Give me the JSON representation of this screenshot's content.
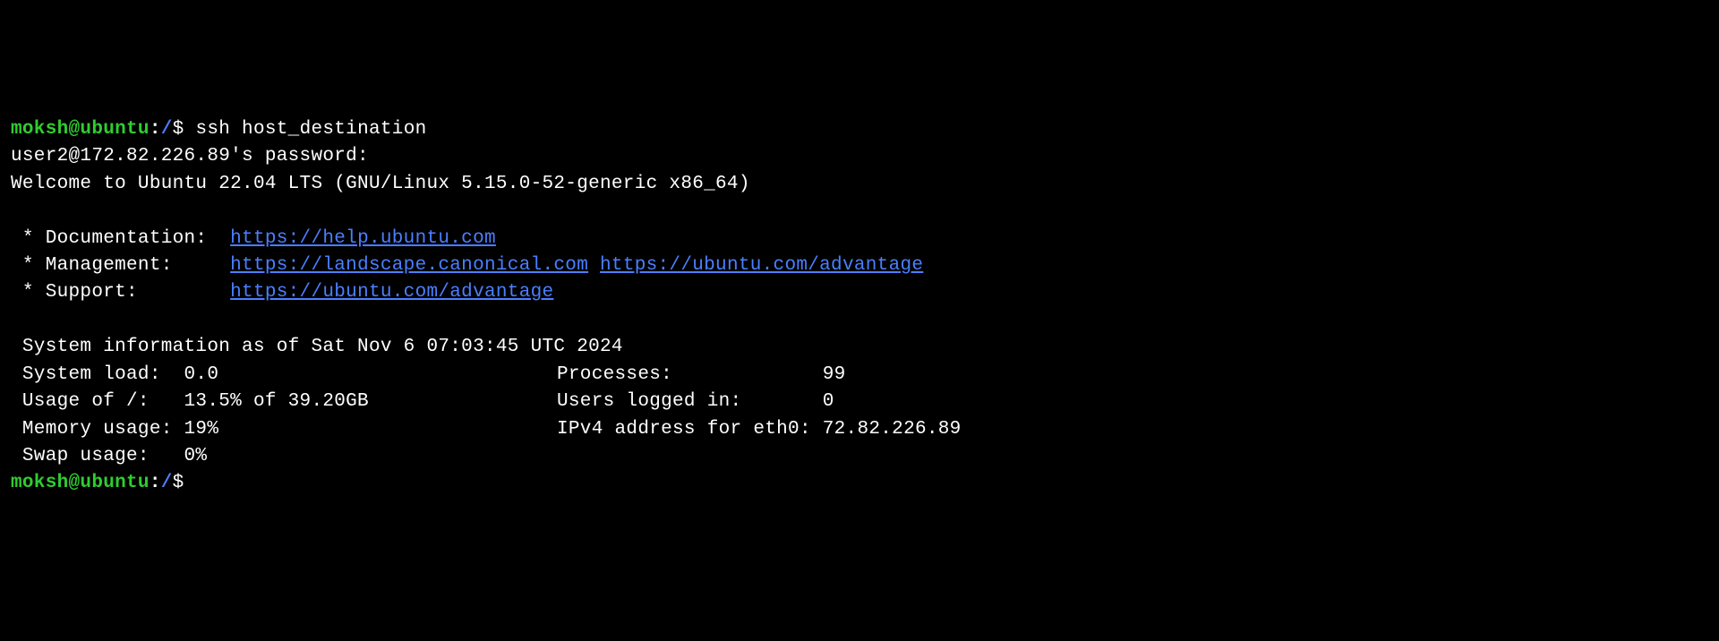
{
  "prompt1": {
    "user": "moksh@ubuntu",
    "colon": ":",
    "path": "/",
    "dollar": "$ ",
    "command": "ssh host_destination"
  },
  "password_line": "user2@172.82.226.89's password:",
  "welcome": "Welcome to Ubuntu 22.04 LTS (GNU/Linux 5.15.0-52-generic x86_64)",
  "info_links": {
    "doc_label": " * Documentation:  ",
    "doc_url": "https://help.ubuntu.com",
    "mgmt_label": " * Management:     ",
    "mgmt_url1": "https://landscape.canonical.com",
    "mgmt_url2": "https://ubuntu.com/advantage",
    "sup_label": " * Support:        ",
    "sup_url": "https://ubuntu.com/advantage"
  },
  "sysinfo_header": " System information as of Sat Nov 6 07:03:45 UTC 2024",
  "sysinfo": {
    "load_label": " System load:  ",
    "load_value": "0.0",
    "proc_label": "Processes:             ",
    "proc_value": "99",
    "usage_label": " Usage of /:   ",
    "usage_value": "13.5% of 39.20GB",
    "users_label": "Users logged in:       ",
    "users_value": "0",
    "mem_label": " Memory usage: ",
    "mem_value": "19%",
    "ipv4_label": "IPv4 address for eth0: ",
    "ipv4_value": "72.82.226.89",
    "swap_label": " Swap usage:   ",
    "swap_value": "0%"
  },
  "prompt2": {
    "user": "moksh@ubuntu",
    "colon": ":",
    "path": "/",
    "dollar": "$"
  }
}
